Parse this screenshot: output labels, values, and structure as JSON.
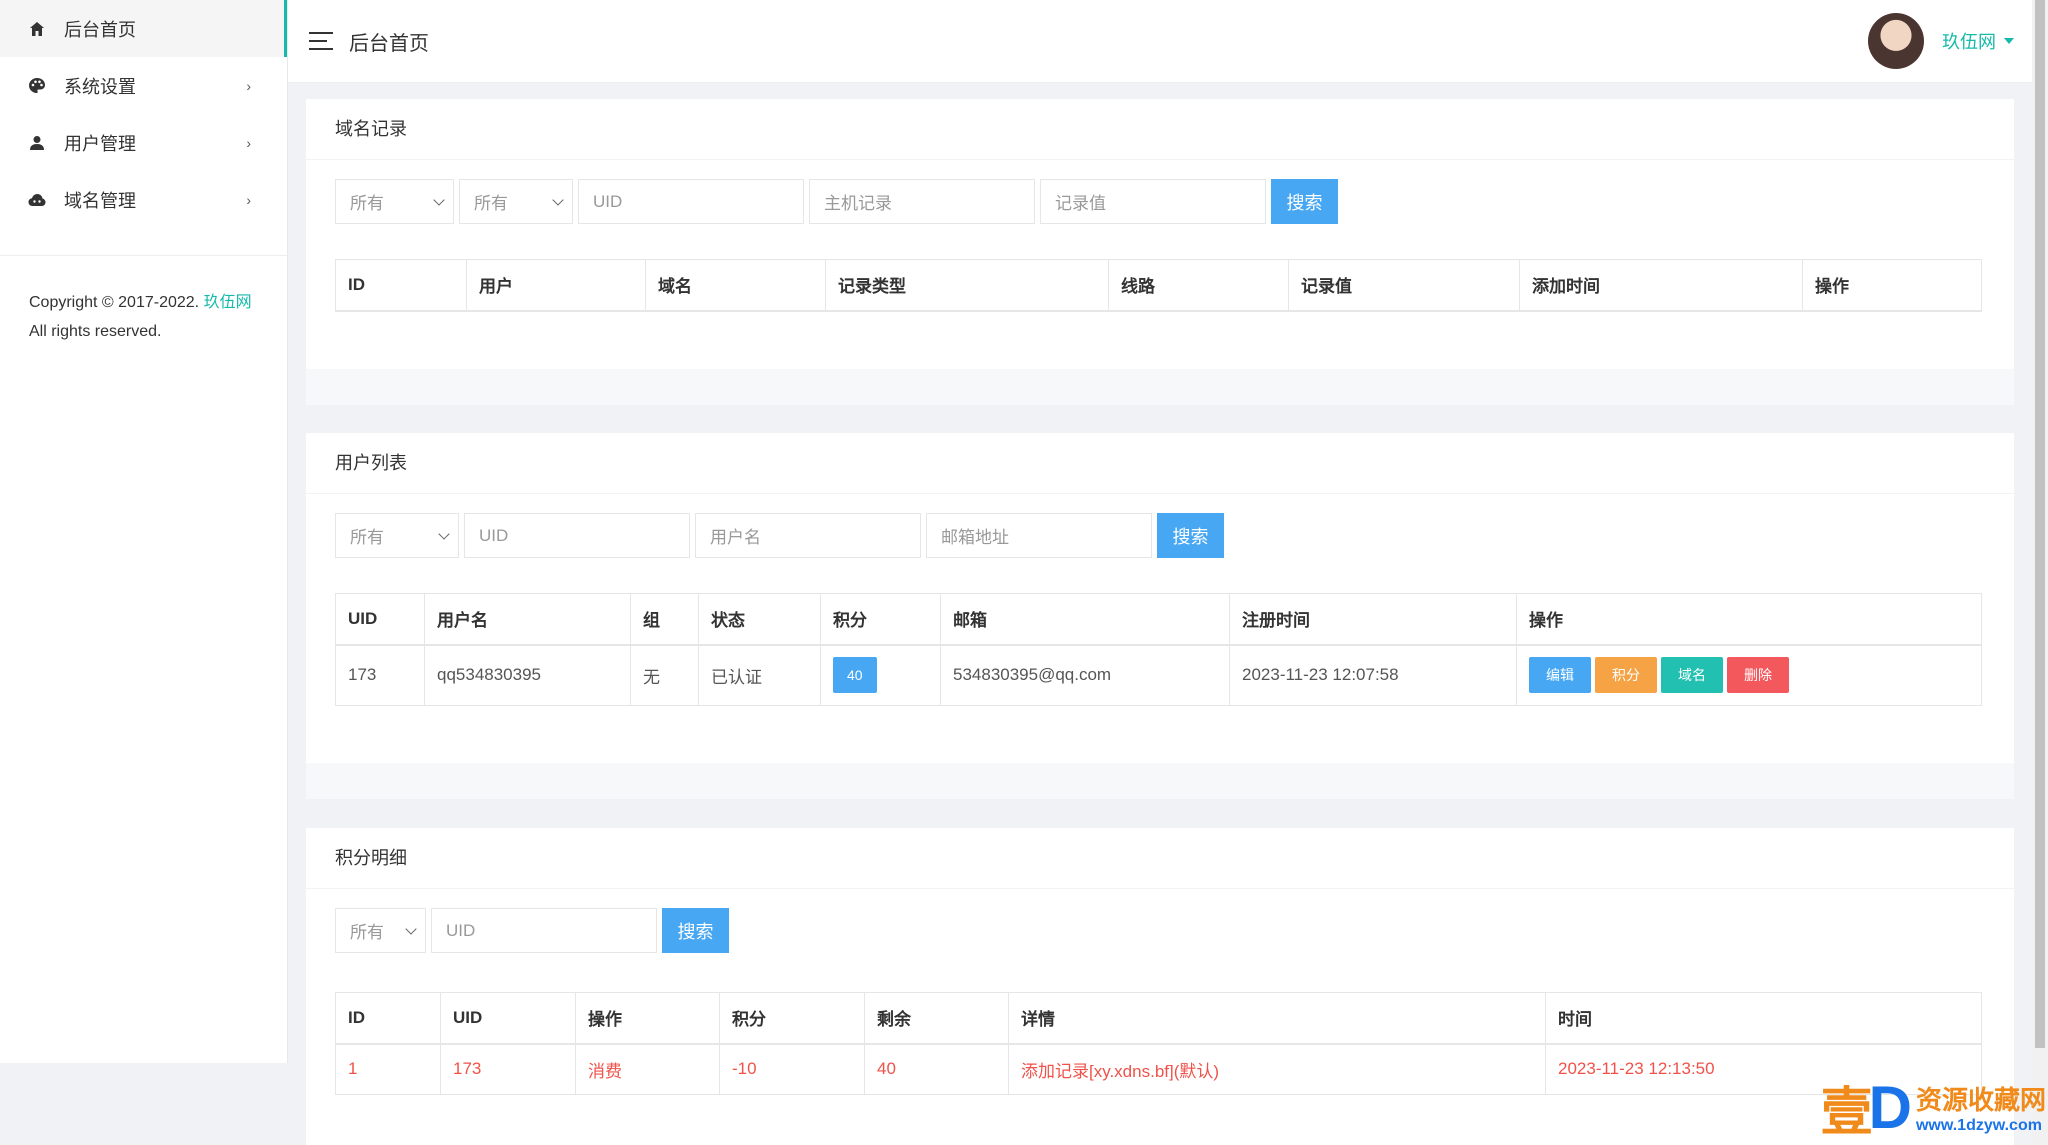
{
  "sidebar": {
    "items": [
      {
        "label": "后台首页",
        "icon": "home-icon"
      },
      {
        "label": "系统设置",
        "icon": "palette-icon"
      },
      {
        "label": "用户管理",
        "icon": "user-icon"
      },
      {
        "label": "域名管理",
        "icon": "cloud-icon"
      }
    ],
    "copyright_prefix": "Copyright © 2017-2022.",
    "copyright_link": "玖伍网",
    "copyright_suffix": "All rights reserved."
  },
  "header": {
    "title": "后台首页",
    "user_name": "玖伍网"
  },
  "domain_records": {
    "title": "域名记录",
    "filters": {
      "select1": "所有",
      "select2": "所有",
      "uid_placeholder": "UID",
      "host_placeholder": "主机记录",
      "value_placeholder": "记录值",
      "search_label": "搜索"
    },
    "columns": [
      "ID",
      "用户",
      "域名",
      "记录类型",
      "线路",
      "记录值",
      "添加时间",
      "操作"
    ]
  },
  "user_list": {
    "title": "用户列表",
    "filters": {
      "select1": "所有",
      "uid_placeholder": "UID",
      "username_placeholder": "用户名",
      "email_placeholder": "邮箱地址",
      "search_label": "搜索"
    },
    "columns": [
      "UID",
      "用户名",
      "组",
      "状态",
      "积分",
      "邮箱",
      "注册时间",
      "操作"
    ],
    "rows": [
      {
        "uid": "173",
        "username": "qq534830395",
        "group": "无",
        "status": "已认证",
        "points": "40",
        "email": "534830395@qq.com",
        "reg_time": "2023-11-23 12:07:58",
        "actions": [
          "编辑",
          "积分",
          "域名",
          "删除"
        ]
      }
    ]
  },
  "points_detail": {
    "title": "积分明细",
    "filters": {
      "select1": "所有",
      "uid_placeholder": "UID",
      "search_label": "搜索"
    },
    "columns": [
      "ID",
      "UID",
      "操作",
      "积分",
      "剩余",
      "详情",
      "时间"
    ],
    "rows": [
      {
        "id": "1",
        "uid": "173",
        "action": "消费",
        "points": "-10",
        "remain": "40",
        "detail": "添加记录[xy.xdns.bf](默认)",
        "time": "2023-11-23 12:13:50"
      }
    ]
  },
  "watermark": {
    "big": "壹",
    "d": "D",
    "line1": "资源收藏网",
    "line2": "www.1dzyw.com"
  },
  "colors": {
    "accent": "#16baaa",
    "primary": "#47a7f3",
    "danger": "#f3585d",
    "warning": "#f6a346"
  }
}
